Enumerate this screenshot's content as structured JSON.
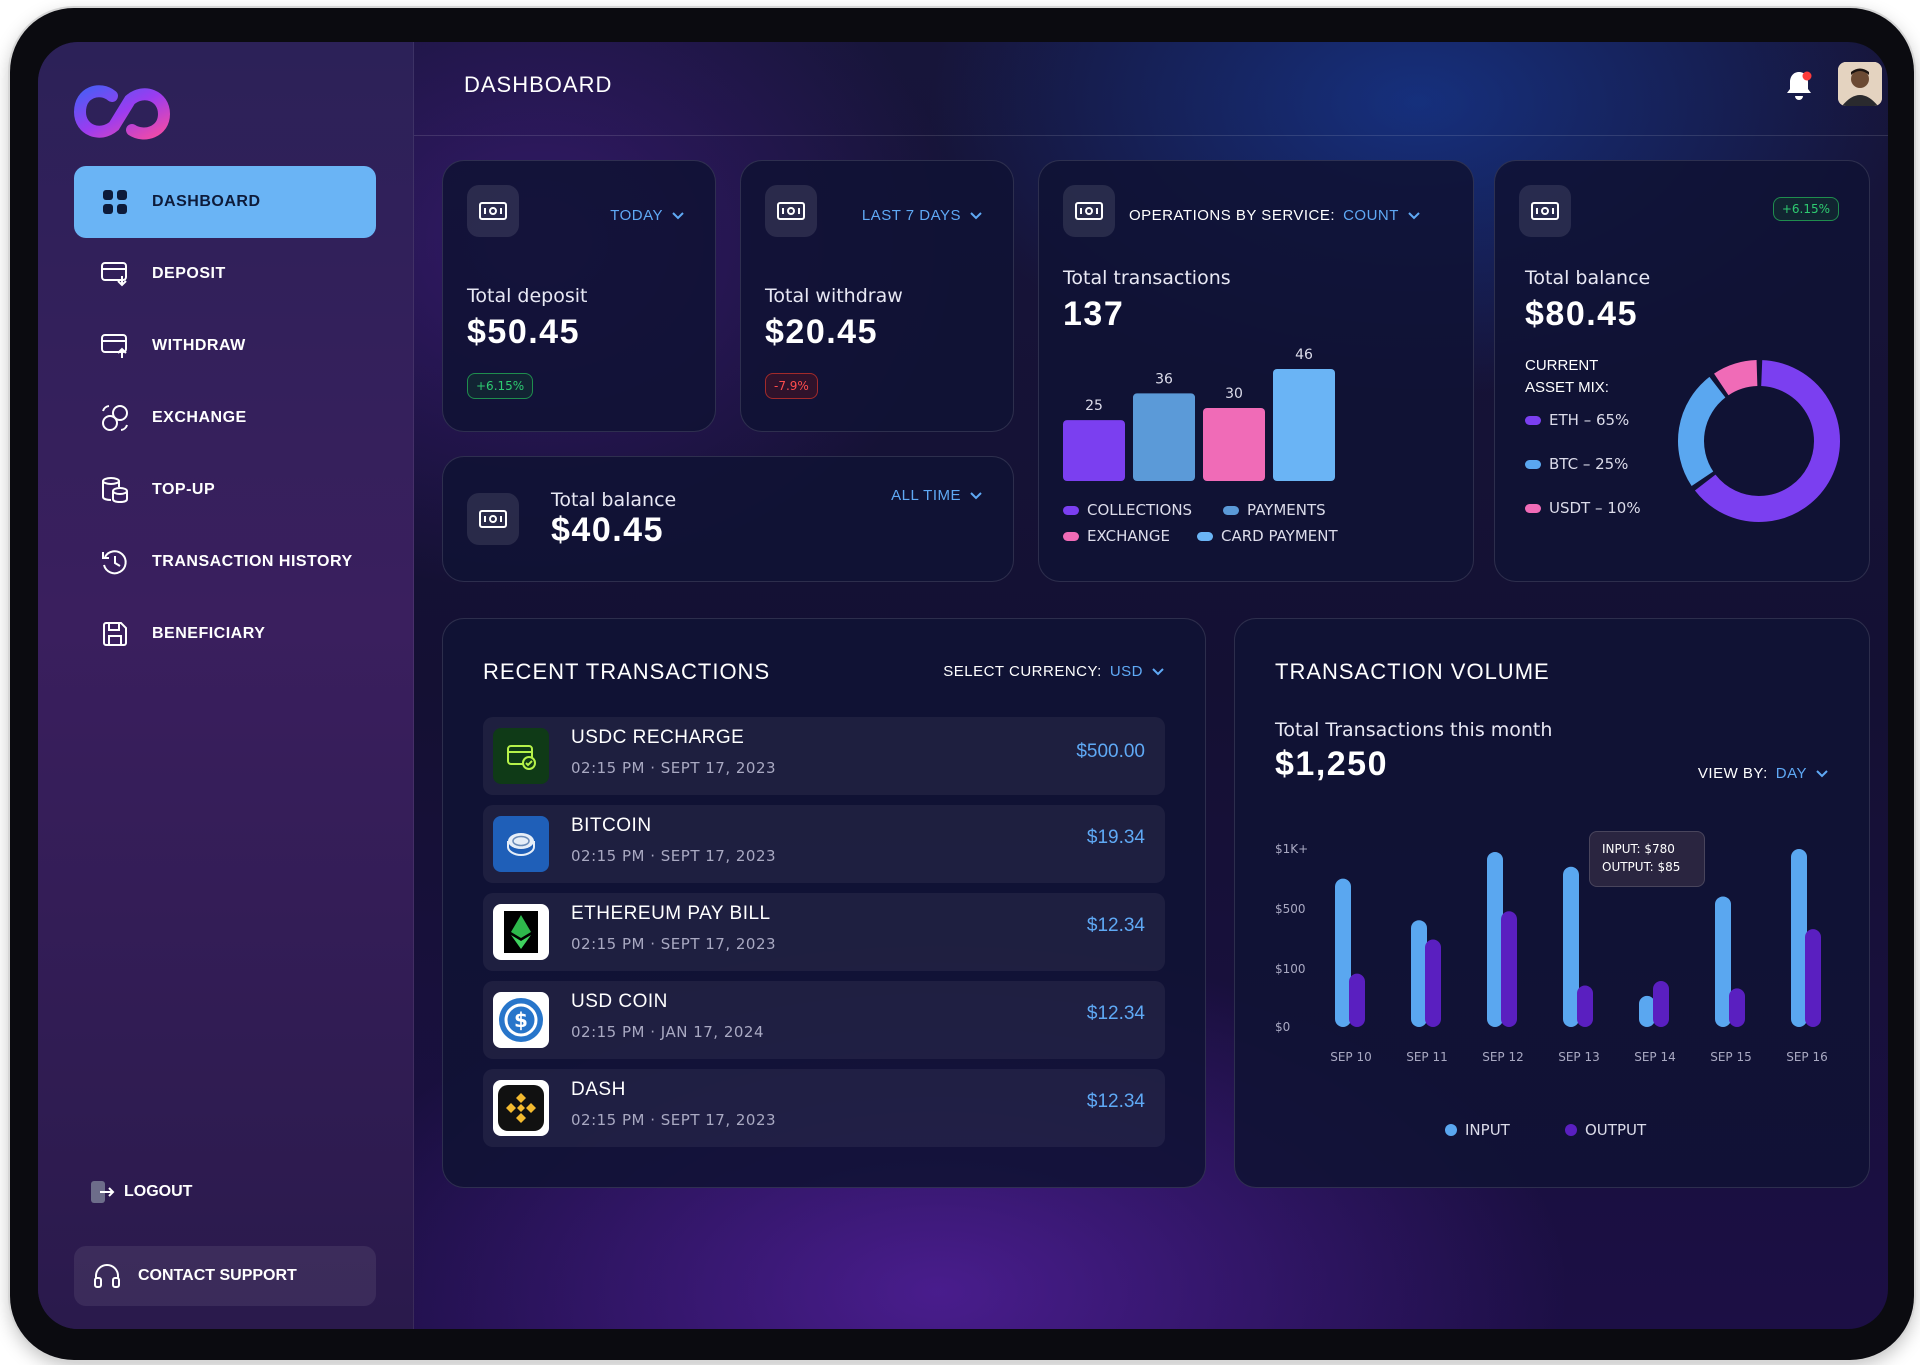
{
  "sidebar": {
    "items": [
      {
        "label": "DASHBOARD",
        "icon": "grid-icon",
        "active": true
      },
      {
        "label": "DEPOSIT",
        "icon": "card-in-icon"
      },
      {
        "label": "WITHDRAW",
        "icon": "card-out-icon"
      },
      {
        "label": "EXCHANGE",
        "icon": "exchange-icon"
      },
      {
        "label": "TOP-UP",
        "icon": "coins-icon"
      },
      {
        "label": "TRANSACTION HISTORY",
        "icon": "clock-icon"
      },
      {
        "label": "BENEFICIARY",
        "icon": "save-icon"
      }
    ],
    "logout_label": "LOGOUT",
    "support_label": "CONTACT SUPPORT"
  },
  "header": {
    "title": "DASHBOARD"
  },
  "cards": {
    "deposit": {
      "range": "TODAY",
      "label": "Total deposit",
      "value": "$50.45",
      "badge": "+6.15%"
    },
    "withdraw": {
      "range": "LAST 7 DAYS",
      "label": "Total withdraw",
      "value": "$20.45",
      "badge": "-7.9%"
    },
    "balance_all": {
      "range": "ALL TIME",
      "label": "Total balance",
      "value": "$40.45"
    },
    "operations": {
      "prefix": "OPERATIONS BY SERVICE:",
      "mode": "COUNT",
      "label": "Total transactions",
      "value": "137"
    },
    "balance_mix": {
      "badge": "+6.15%",
      "label": "Total balance",
      "value": "$80.45",
      "mix_title_1": "CURRENT",
      "mix_title_2": "ASSET MIX:",
      "mix": [
        {
          "label": "ETH – 65%",
          "value": 65,
          "color": "#7b3ff0"
        },
        {
          "label": "BTC – 25%",
          "value": 25,
          "color": "#5aa7f0"
        },
        {
          "label": "USDT – 10%",
          "value": 10,
          "color": "#f06bb7"
        }
      ]
    }
  },
  "chart_data": [
    {
      "type": "bar",
      "categories": [
        "COLLECTIONS",
        "PAYMENTS",
        "EXCHANGE",
        "CARD PAYMENT"
      ],
      "values": [
        25,
        36,
        30,
        46
      ],
      "colors": [
        "#7b3ff0",
        "#5b9ad8",
        "#f06bb7",
        "#6ab4f5"
      ],
      "title": "",
      "xlabel": "",
      "ylabel": "",
      "grid": false,
      "legend": "bottom"
    },
    {
      "type": "bar",
      "categories": [
        "SEP 10",
        "SEP 11",
        "SEP 12",
        "SEP 13",
        "SEP 14",
        "SEP 15",
        "SEP 16"
      ],
      "y_ticks": [
        "$1K+",
        "$500",
        "$100",
        "$0"
      ],
      "series": [
        {
          "name": "INPUT",
          "color": "#5aa7f0",
          "values": [
            1000,
            720,
            1180,
            1080,
            210,
            880,
            1200
          ]
        },
        {
          "name": "OUTPUT",
          "color": "#5a1fc0",
          "values": [
            360,
            590,
            780,
            280,
            310,
            260,
            660
          ]
        }
      ],
      "tooltip": {
        "line1": "INPUT: $780",
        "line2": "OUTPUT: $85"
      },
      "grid": false,
      "legend": "bottom"
    }
  ],
  "recent": {
    "title": "RECENT TRANSACTIONS",
    "currency_prefix": "SELECT CURRENCY:",
    "currency": "USD",
    "rows": [
      {
        "name": "USDC RECHARGE",
        "date": "02:15 PM · SEPT 17, 2023",
        "amount": "$500.00",
        "icon": "wallet-check-icon"
      },
      {
        "name": "BITCOIN",
        "date": "02:15 PM · SEPT 17, 2023",
        "amount": "$19.34",
        "icon": "coin-stack-icon"
      },
      {
        "name": "ETHEREUM PAY BILL",
        "date": "02:15 PM · SEPT 17, 2023",
        "amount": "$12.34",
        "icon": "ethereum-icon"
      },
      {
        "name": "USD COIN",
        "date": "02:15 PM · JAN 17, 2024",
        "amount": "$12.34",
        "icon": "usd-coin-icon"
      },
      {
        "name": "DASH",
        "date": "02:15 PM · SEPT 17, 2023",
        "amount": "$12.34",
        "icon": "binance-icon"
      }
    ]
  },
  "volume": {
    "title": "TRANSACTION VOLUME",
    "label": "Total Transactions this month",
    "value": "$1,250",
    "view_prefix": "VIEW BY:",
    "view": "DAY"
  }
}
